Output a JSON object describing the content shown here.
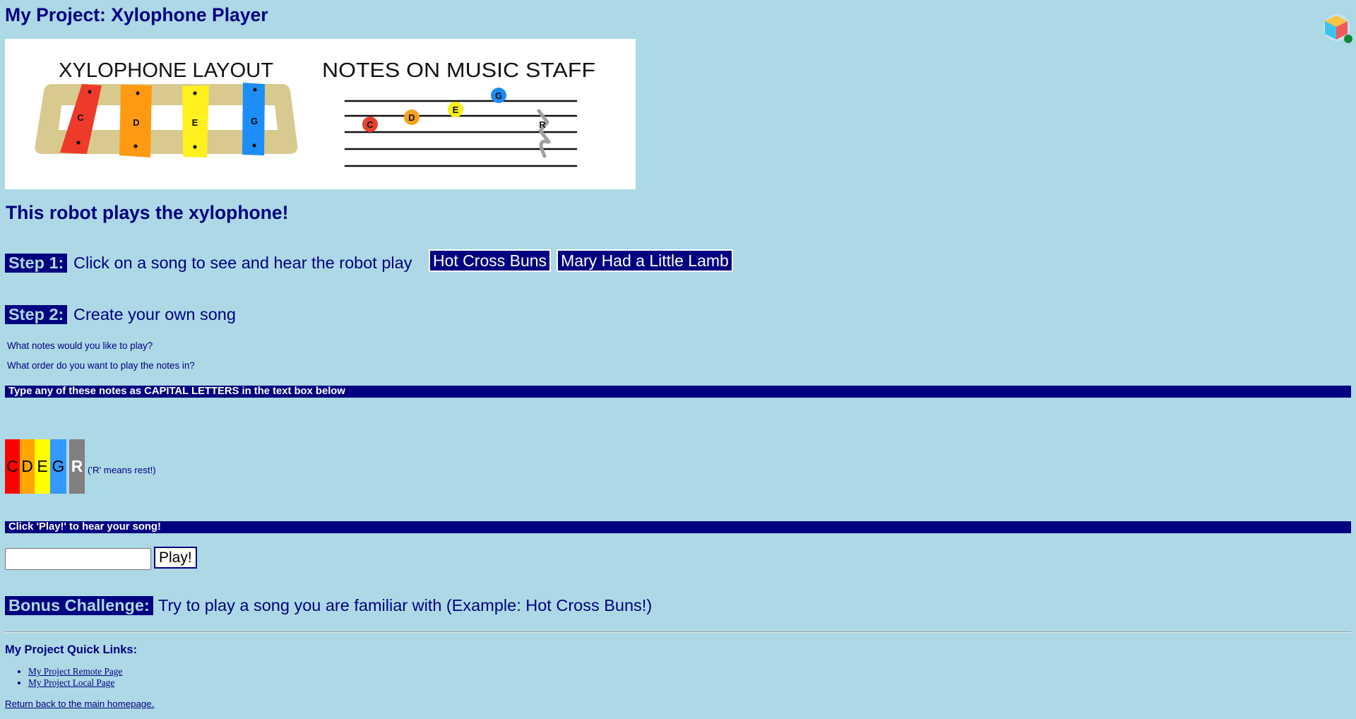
{
  "page": {
    "title": "My Project: Xylophone Player",
    "subtitle": "This robot plays the xylophone!"
  },
  "colors": {
    "background": "#add8e6",
    "primary": "#000080",
    "badge_text": "#add8e6",
    "bar_text": "#ffffff",
    "link": "#000080"
  },
  "banner_image": {
    "left_title": "XYLOPHONE LAYOUT",
    "right_title": "NOTES ON MUSIC STAFF",
    "frame_color": "#d8c98f",
    "xylophone_bars": [
      {
        "note": "C",
        "color": "#ee3a2a"
      },
      {
        "note": "D",
        "color": "#ff9a12"
      },
      {
        "note": "E",
        "color": "#fff01e"
      },
      {
        "note": "G",
        "color": "#1e8df5"
      }
    ],
    "staff_notes": [
      {
        "note": "C",
        "color": "#e8402f"
      },
      {
        "note": "D",
        "color": "#f7a21b"
      },
      {
        "note": "E",
        "color": "#f5ec1e"
      },
      {
        "note": "G",
        "color": "#1e8cf0"
      },
      {
        "note": "R",
        "color": "#a0a0a0"
      }
    ]
  },
  "step1": {
    "badge": "Step 1:",
    "text": "Click on a song to see and hear the robot play",
    "songs": [
      "Hot Cross Buns",
      "Mary Had a Little Lamb"
    ]
  },
  "step2": {
    "badge": "Step 2:",
    "text": "Create your own song",
    "questions": [
      "What notes would you like to play?",
      "What order do you want to play the notes in?"
    ]
  },
  "notes_bar": "Type any of these notes as CAPITAL LETTERS in the text box below",
  "note_keys": [
    {
      "note": "C",
      "color": "#ff0000"
    },
    {
      "note": "D",
      "color": "#ffa500"
    },
    {
      "note": "E",
      "color": "#ffff00"
    },
    {
      "note": "G",
      "color": "#3399ff"
    },
    {
      "note": "R",
      "color": "#808080"
    }
  ],
  "rest_hint": "('R' means rest!)",
  "play_bar": "Click 'Play!' to hear your song!",
  "song_input": {
    "value": ""
  },
  "play_button": "Play!",
  "bonus": {
    "badge": "Bonus Challenge:",
    "text": "Try to play a song you are familiar with (Example: Hot Cross Buns!)"
  },
  "quick_links": {
    "heading": "My Project Quick Links:",
    "links": [
      "My Project Remote Page",
      "My Project Local Page"
    ]
  },
  "footer_link": "Return back to the main homepage.",
  "icons": {
    "corner_icon": "cube-extension-icon"
  }
}
